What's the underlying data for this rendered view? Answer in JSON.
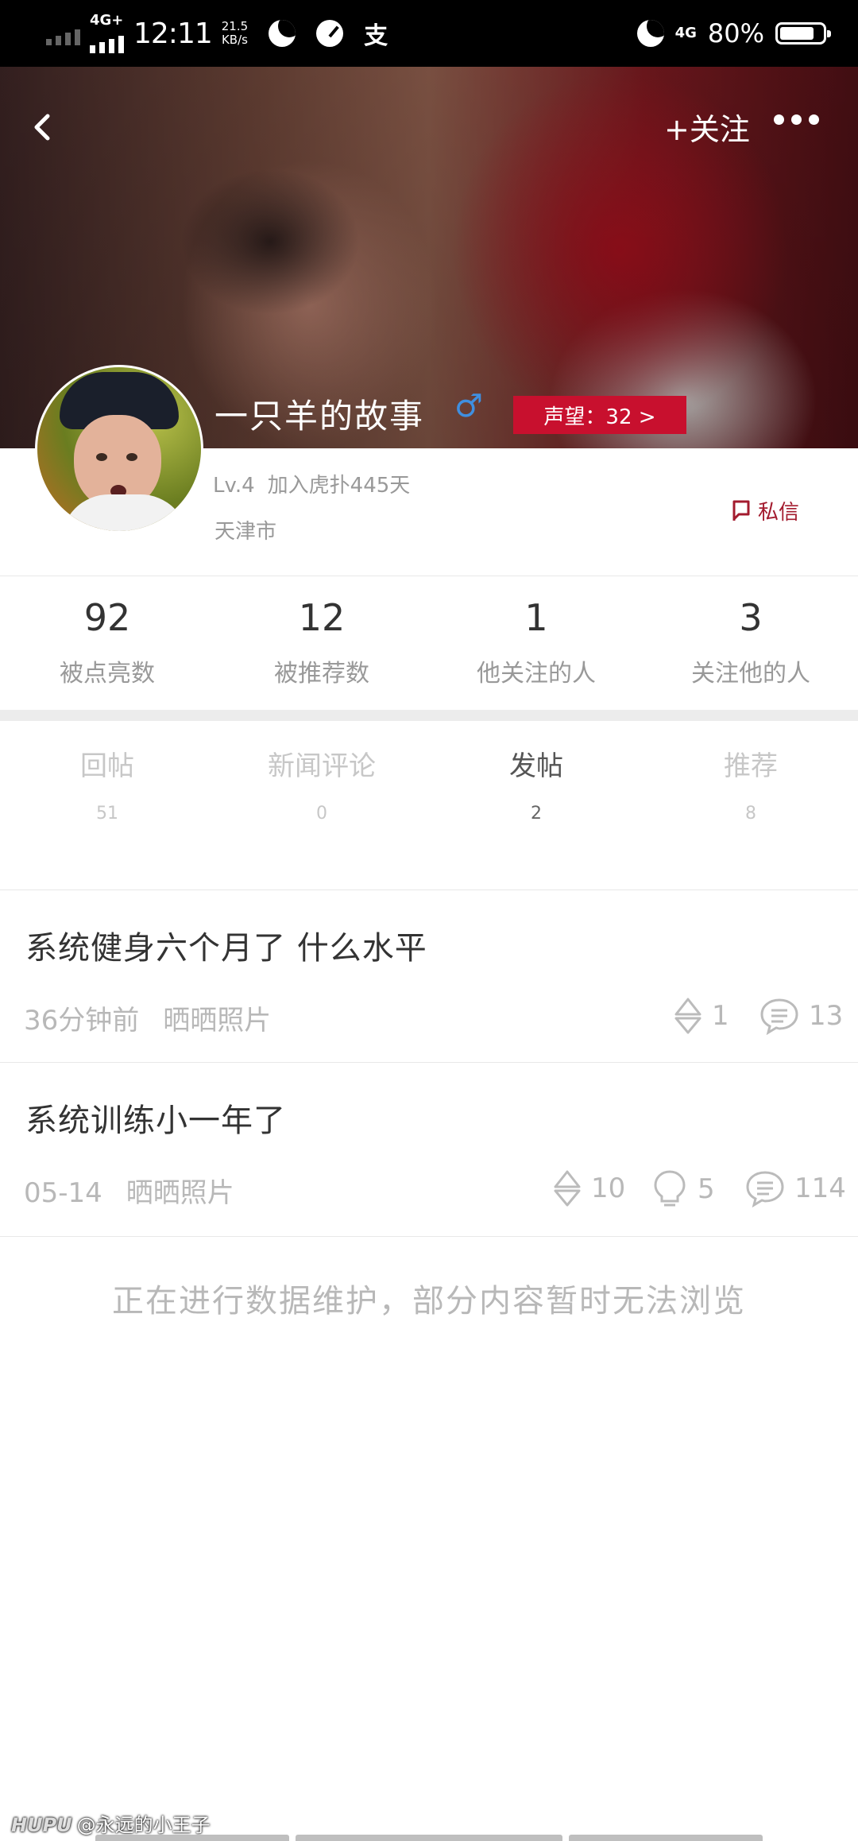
{
  "status_bar": {
    "network_left": "4G+",
    "time": "12:11",
    "speed_value": "21.5",
    "speed_unit": "KB/s",
    "app_icon": "支",
    "network_right": "4G",
    "battery_percent": "80%",
    "battery_level": 0.8
  },
  "header": {
    "follow_label": "+关注"
  },
  "profile": {
    "username": "一只羊的故事",
    "gender_symbol": "♂",
    "prestige": "声望：32 >",
    "level": "Lv.4",
    "joined": "加入虎扑445天",
    "city": "天津市",
    "message_label": "私信"
  },
  "stats": [
    {
      "value": "92",
      "label": "被点亮数"
    },
    {
      "value": "12",
      "label": "被推荐数"
    },
    {
      "value": "1",
      "label": "他关注的人"
    },
    {
      "value": "3",
      "label": "关注他的人"
    }
  ],
  "tabs": [
    {
      "label": "回帖",
      "count": "51",
      "active": false
    },
    {
      "label": "新闻评论",
      "count": "0",
      "active": false
    },
    {
      "label": "发帖",
      "count": "2",
      "active": true
    },
    {
      "label": "推荐",
      "count": "8",
      "active": false
    }
  ],
  "posts": [
    {
      "title": "系统健身六个月了 什么水平",
      "time": "36分钟前",
      "board": "晒晒照片",
      "votes": "1",
      "comments": "13"
    },
    {
      "title": "系统训练小一年了",
      "time": "05-14",
      "board": "晒晒照片",
      "votes": "10",
      "lights": "5",
      "comments": "114"
    }
  ],
  "notice": "正在进行数据维护，部分内容暂时无法浏览",
  "watermark": {
    "brand": "HUPU",
    "author": "@永远的小王子"
  },
  "colors": {
    "accent_red": "#c8102e",
    "message_red": "#a31b2e",
    "gender_blue": "#3f8fe0"
  }
}
